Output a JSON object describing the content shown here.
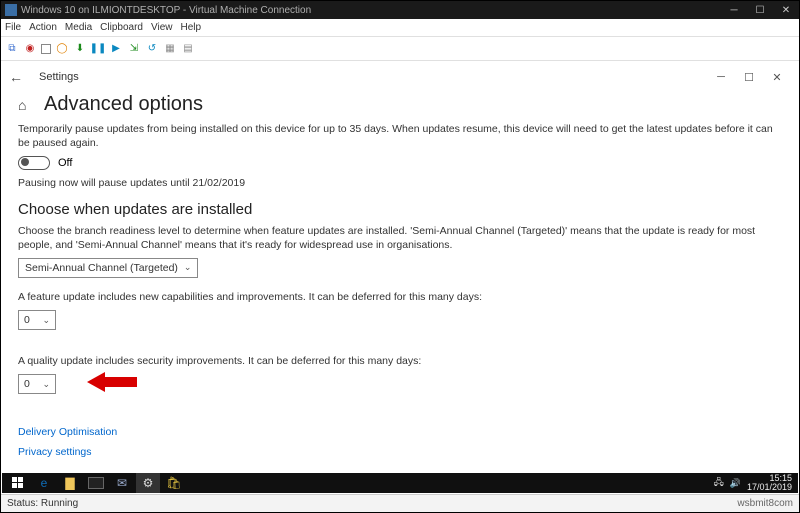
{
  "vm": {
    "title": "Windows 10 on ILMIONTDESKTOP - Virtual Machine Connection",
    "menu": [
      "File",
      "Action",
      "Media",
      "Clipboard",
      "View",
      "Help"
    ]
  },
  "settings": {
    "app_label": "Settings",
    "page_title": "Advanced options",
    "pause_description": "Temporarily pause updates from being installed on this device for up to 35 days. When updates resume, this device will need to get the latest updates before it can be paused again.",
    "pause_toggle_state": "Off",
    "pause_date_text": "Pausing now will pause updates until 21/02/2019",
    "choose_heading": "Choose when updates are installed",
    "choose_description": "Choose the branch readiness level to determine when feature updates are installed. 'Semi-Annual Channel (Targeted)' means that the update is ready for most people, and 'Semi-Annual Channel' means that it's ready for widespread use in organisations.",
    "branch_combo_value": "Semi-Annual Channel (Targeted)",
    "feature_defer_text": "A feature update includes new capabilities and improvements. It can be deferred for this many days:",
    "feature_defer_value": "0",
    "quality_defer_text": "A quality update includes security improvements. It can be deferred for this many days:",
    "quality_defer_value": "0",
    "link_delivery": "Delivery Optimisation",
    "link_privacy": "Privacy settings"
  },
  "taskbar": {
    "time": "15:15",
    "date": "17/01/2019"
  },
  "statusbar": {
    "status": "Status: Running",
    "right": "wsbmit8com"
  }
}
